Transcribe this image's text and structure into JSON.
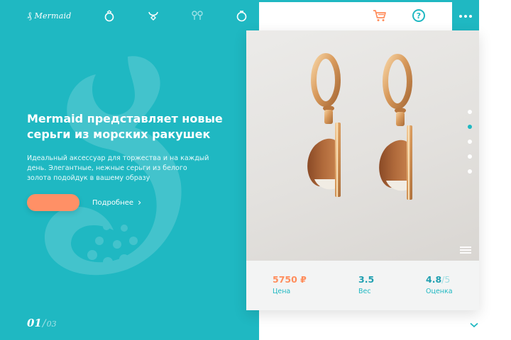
{
  "brand": {
    "mark": "₰",
    "name": "Mermaid"
  },
  "nav": {
    "icons": [
      "ring-icon",
      "necklace-icon",
      "earrings-icon",
      "bracelet-icon",
      "cart-icon",
      "help-icon",
      "menu-icon"
    ],
    "help_glyph": "?"
  },
  "hero": {
    "headline": "Mermaid представляет новые серьги из морских ракушек",
    "description": "Идеальный аксессуар для торжества и на каждый день. Элегантные, нежные серьги из белого золота подойдук в вашему образу",
    "more_link": "Подробнее",
    "more_arrow": "›"
  },
  "pager": {
    "current": "01",
    "separator": "/",
    "total": "03"
  },
  "product": {
    "price": {
      "value": "5750 ₽",
      "label": "Цена"
    },
    "weight": {
      "value": "3.5",
      "label": "Вес"
    },
    "rating": {
      "value": "4.8",
      "max": "/5",
      "label": "Оценка"
    }
  },
  "slider": {
    "count": 5,
    "active_index": 1
  },
  "colors": {
    "teal": "#1fb8c2",
    "coral": "#ff9066",
    "price": "#ff8d5c",
    "stat_dark": "#1f9fb0",
    "white": "#ffffff"
  }
}
